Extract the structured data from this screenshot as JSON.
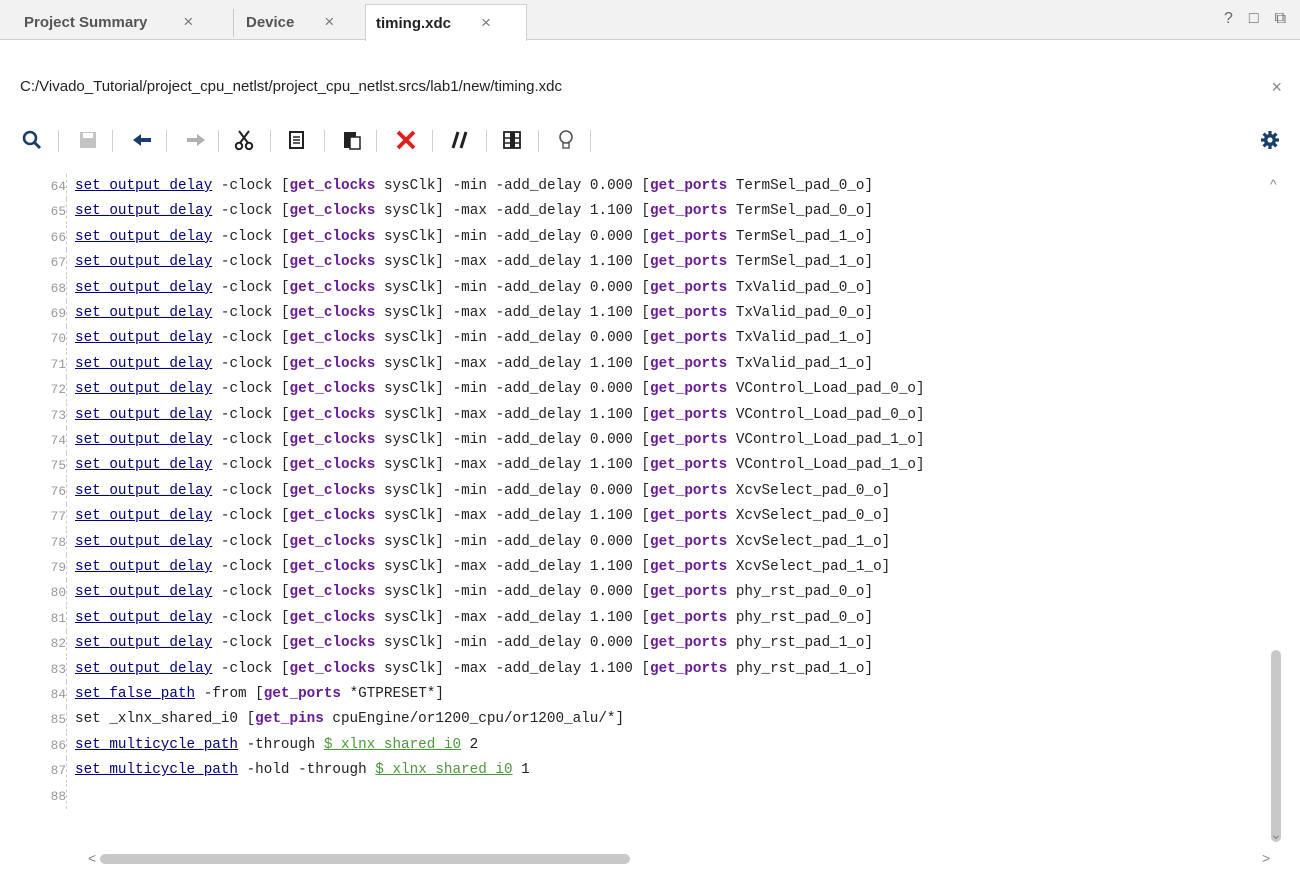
{
  "tabs": [
    {
      "label": "Project Summary",
      "close": "×"
    },
    {
      "label": "Device",
      "close": "×"
    },
    {
      "label": "timing.xdc",
      "close": "×"
    }
  ],
  "window_icons": {
    "help": "?",
    "maximize": "□",
    "restore": "⧉"
  },
  "file_path": "C:/Vivado_Tutorial/project_cpu_netlst/project_cpu_netlst.srcs/lab1/new/timing.xdc",
  "path_close": "×",
  "toolbar_icons": [
    "search-icon",
    "save-icon",
    "undo-icon",
    "redo-icon",
    "cut-icon",
    "copy-icon",
    "paste-icon",
    "delete-icon",
    "comment-icon",
    "column-select-icon",
    "quick-help-icon",
    "settings-icon"
  ],
  "colors": {
    "command": "#000080",
    "keyword": "#6a1b9a",
    "variable": "#4a9a3a",
    "line_number": "#999999"
  },
  "code_lines": [
    {
      "n": "64",
      "p1": "-clock",
      "cmd": "set_output_delay",
      "clk": "sysClk]",
      "mode": "-min",
      "val": "0.000",
      "port": "TermSel_pad_0_o]"
    },
    {
      "n": "65",
      "p1": "-clock",
      "cmd": "set_output_delay",
      "clk": "sysClk]",
      "mode": "-max",
      "val": "1.100",
      "port": "TermSel_pad_0_o]"
    },
    {
      "n": "66",
      "p1": "-clock",
      "cmd": "set_output_delay",
      "clk": "sysClk]",
      "mode": "-min",
      "val": "0.000",
      "port": "TermSel_pad_1_o]"
    },
    {
      "n": "67",
      "p1": "-clock",
      "cmd": "set_output_delay",
      "clk": "sysClk]",
      "mode": "-max",
      "val": "1.100",
      "port": "TermSel_pad_1_o]"
    },
    {
      "n": "68",
      "p1": "-clock",
      "cmd": "set_output_delay",
      "clk": "sysClk]",
      "mode": "-min",
      "val": "0.000",
      "port": "TxValid_pad_0_o]"
    },
    {
      "n": "69",
      "p1": "-clock",
      "cmd": "set_output_delay",
      "clk": "sysClk]",
      "mode": "-max",
      "val": "1.100",
      "port": "TxValid_pad_0_o]"
    },
    {
      "n": "70",
      "p1": "-clock",
      "cmd": "set_output_delay",
      "clk": "sysClk]",
      "mode": "-min",
      "val": "0.000",
      "port": "TxValid_pad_1_o]"
    },
    {
      "n": "71",
      "p1": "-clock",
      "cmd": "set_output_delay",
      "clk": "sysClk]",
      "mode": "-max",
      "val": "1.100",
      "port": "TxValid_pad_1_o]"
    },
    {
      "n": "72",
      "p1": "-clock",
      "cmd": "set_output_delay",
      "clk": "sysClk]",
      "mode": "-min",
      "val": "0.000",
      "port": "VControl_Load_pad_0_o]"
    },
    {
      "n": "73",
      "p1": "-clock",
      "cmd": "set_output_delay",
      "clk": "sysClk]",
      "mode": "-max",
      "val": "1.100",
      "port": "VControl_Load_pad_0_o]"
    },
    {
      "n": "74",
      "p1": "-clock",
      "cmd": "set_output_delay",
      "clk": "sysClk]",
      "mode": "-min",
      "val": "0.000",
      "port": "VControl_Load_pad_1_o]"
    },
    {
      "n": "75",
      "p1": "-clock",
      "cmd": "set_output_delay",
      "clk": "sysClk]",
      "mode": "-max",
      "val": "1.100",
      "port": "VControl_Load_pad_1_o]"
    },
    {
      "n": "76",
      "p1": "-clock",
      "cmd": "set_output_delay",
      "clk": "sysClk]",
      "mode": "-min",
      "val": "0.000",
      "port": "XcvSelect_pad_0_o]"
    },
    {
      "n": "77",
      "p1": "-clock",
      "cmd": "set_output_delay",
      "clk": "sysClk]",
      "mode": "-max",
      "val": "1.100",
      "port": "XcvSelect_pad_0_o]"
    },
    {
      "n": "78",
      "p1": "-clock",
      "cmd": "set_output_delay",
      "clk": "sysClk]",
      "mode": "-min",
      "val": "0.000",
      "port": "XcvSelect_pad_1_o]"
    },
    {
      "n": "79",
      "p1": "-clock",
      "cmd": "set_output_delay",
      "clk": "sysClk]",
      "mode": "-max",
      "val": "1.100",
      "port": "XcvSelect_pad_1_o]"
    },
    {
      "n": "80",
      "p1": "-clock",
      "cmd": "set_output_delay",
      "clk": "sysClk]",
      "mode": "-min",
      "val": "0.000",
      "port": "phy_rst_pad_0_o]"
    },
    {
      "n": "81",
      "p1": "-clock",
      "cmd": "set_output_delay",
      "clk": "sysClk]",
      "mode": "-max",
      "val": "1.100",
      "port": "phy_rst_pad_0_o]"
    },
    {
      "n": "82",
      "p1": "-clock",
      "cmd": "set_output_delay",
      "clk": "sysClk]",
      "mode": "-min",
      "val": "0.000",
      "port": "phy_rst_pad_1_o]"
    },
    {
      "n": "83",
      "p1": "-clock",
      "cmd": "set_output_delay",
      "clk": "sysClk]",
      "mode": "-max",
      "val": "1.100",
      "port": "phy_rst_pad_1_o]"
    }
  ],
  "tail_lines": [
    {
      "n": "84",
      "cmd": "set_false_path",
      "a": " -from [",
      "kw": "get_ports",
      "b": " *GTPRESET*]"
    },
    {
      "n": "85",
      "plain": "set _xlnx_shared_i0 [",
      "kw": "get_pins",
      "b": " cpuEngine/or1200_cpu/or1200_alu/*]"
    },
    {
      "n": "86",
      "cmd": "set_multicycle_path",
      "a": " -through ",
      "var": "$_xlnx_shared_i0",
      "b": " 2"
    },
    {
      "n": "87",
      "cmd": "set_multicycle_path",
      "a": " -hold -through ",
      "var": "$_xlnx_shared_i0",
      "b": " 1"
    },
    {
      "n": "88"
    }
  ],
  "tokens": {
    "get_clocks": "get_clocks",
    "get_ports": "get_ports",
    "add_delay": "-add_delay",
    "open_bracket": "["
  },
  "scroll": {
    "up": "^",
    "down": "⌄",
    "left": "<",
    "right": ">"
  }
}
